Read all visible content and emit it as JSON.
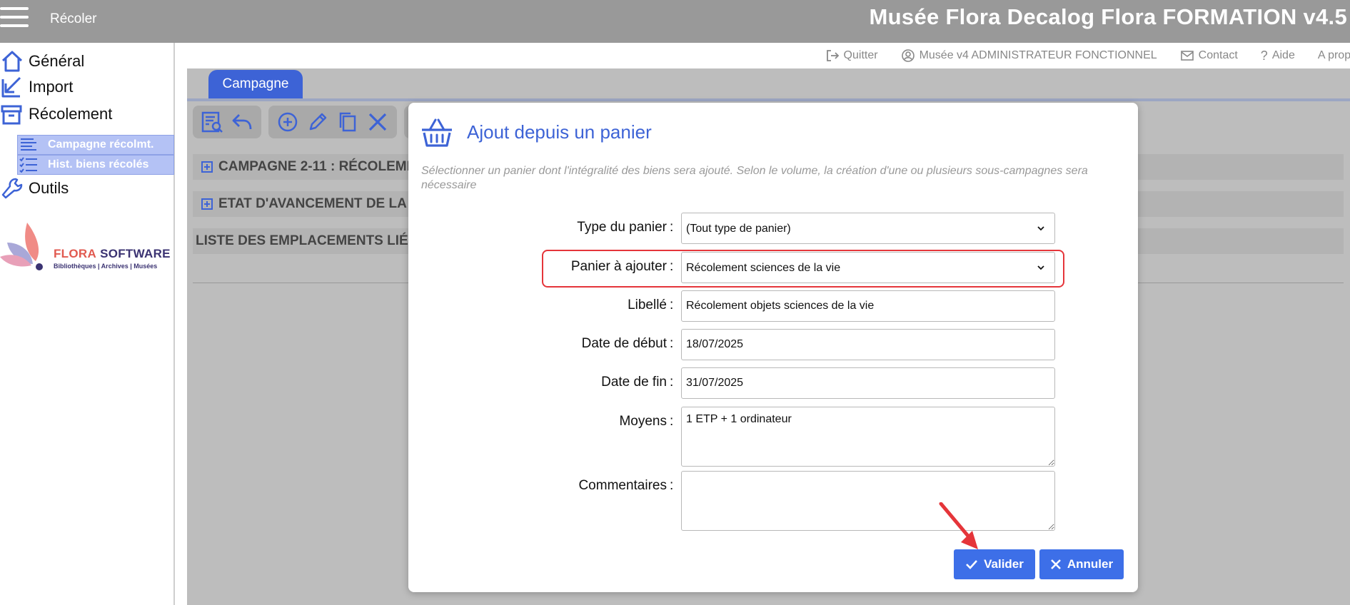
{
  "topbar": {
    "app_name": "Récoler",
    "title": "Musée Flora Decalog Flora FORMATION v4.5"
  },
  "sidebar": {
    "items": [
      {
        "label": "Général",
        "icon": "home-icon"
      },
      {
        "label": "Import",
        "icon": "import-icon"
      },
      {
        "label": "Récolement",
        "icon": "archive-icon"
      },
      {
        "label": "Outils",
        "icon": "wrench-icon"
      }
    ],
    "sub_items": [
      {
        "label": "Campagne récolmt.",
        "icon": "list-icon"
      },
      {
        "label": "Hist. biens récolés",
        "icon": "checklist-icon"
      }
    ],
    "logo": {
      "brand_a": "FLORA",
      "brand_b": " SOFTWARE",
      "tagline": "Bibliothèques | Archives | Musées"
    }
  },
  "subheader": {
    "quit": "Quitter",
    "user": "Musée v4 ADMINISTRATEUR FONCTIONNEL",
    "contact": "Contact",
    "help": "Aide",
    "about": "A propos"
  },
  "main": {
    "tab_label": "Campagne",
    "sections": [
      "CAMPAGNE 2-11 : RÉCOLEME",
      "ETAT D'AVANCEMENT DE LA",
      "LISTE DES EMPLACEMENTS LIÉ"
    ]
  },
  "modal": {
    "title": "Ajout depuis un panier",
    "description": "Sélectionner un panier dont l'intégralité des biens sera ajouté. Selon le volume, la création d'une ou plusieurs sous-campagnes sera nécessaire",
    "colon": ":",
    "fields": {
      "type": {
        "label": "Type du panier",
        "value": "(Tout type de panier)"
      },
      "panier": {
        "label": "Panier à ajouter",
        "value": "Récolement sciences de la vie"
      },
      "libelle": {
        "label": "Libellé",
        "value": "Récolement objets sciences de la vie"
      },
      "date_debut": {
        "label": "Date de début",
        "value": "18/07/2025"
      },
      "date_fin": {
        "label": "Date de fin",
        "value": "31/07/2025"
      },
      "moyens": {
        "label": "Moyens",
        "value": "1 ETP + 1 ordinateur"
      },
      "commentaires": {
        "label": "Commentaires",
        "value": ""
      }
    },
    "validate_label": "Valider",
    "cancel_label": "Annuler"
  },
  "colors": {
    "accent": "#3d63d6",
    "button": "#3d6fe8",
    "highlight": "#e5353a",
    "topbar": "#999999"
  }
}
